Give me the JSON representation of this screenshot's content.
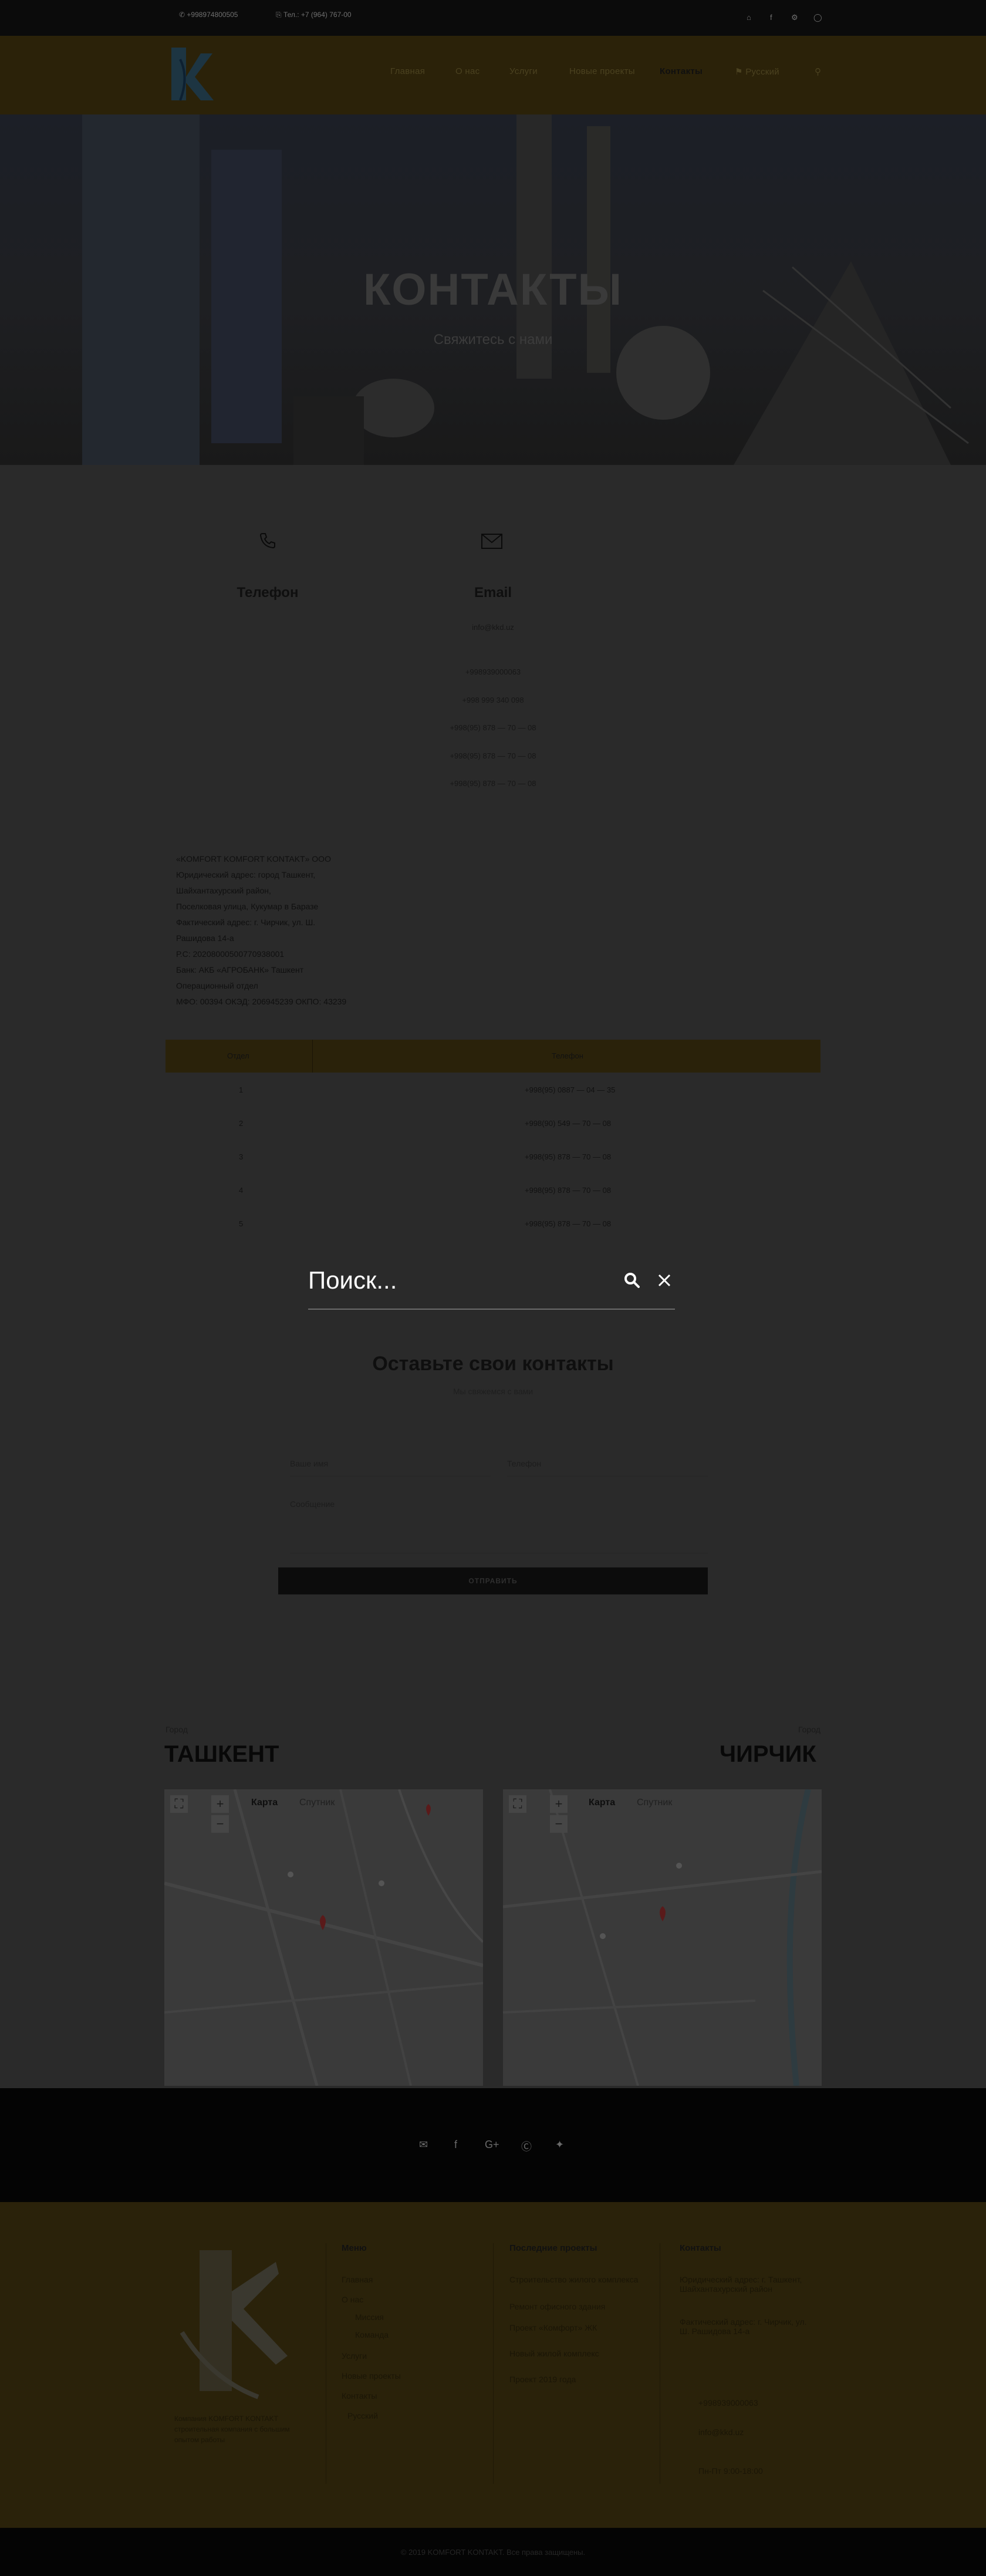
{
  "topbar": {
    "phone": "+998974800505",
    "fax": "Тел.: +7 (964) 767-00",
    "social_icons": [
      "home-icon",
      "facebook-icon",
      "settings-icon",
      "instagram-icon"
    ]
  },
  "nav": {
    "items": [
      "Главная",
      "О нас",
      "Услуги",
      "Новые проекты",
      "Контакты",
      "Русский"
    ],
    "active": "Контакты"
  },
  "hero": {
    "title": "КОНТАКТЫ",
    "subtitle": "Свяжитесь с нами"
  },
  "contacts": {
    "phone_label": "Телефон",
    "email_label": "Email",
    "email_value": "info@kkd.uz",
    "phones": [
      "+998939000063",
      "+998 999 340 098",
      "+998(95) 878 — 70 — 08",
      "+998(95) 878 — 70 — 08",
      "+998(95) 878 — 70 — 08"
    ]
  },
  "requisites": [
    "«KOMFORT KOMFORT KONTAKT» OOO",
    "Юридический адрес: город Ташкент,",
    "Шайхантахурский район,",
    "Поселковая улица, Кукумар в Баразе",
    "Фактический адрес: г. Чирчик, ул. Ш.",
    "Рашидова 14-а",
    "Р.С: 20208000500770938001",
    "Банк: АКБ «АГРОБАНК» Ташкент",
    "Операционный отдел",
    "МФО: 00394 ОКЭД: 206945239 ОКПО: 43239"
  ],
  "table": {
    "headers": [
      "Отдел",
      "Телефон"
    ],
    "rows": [
      [
        "1",
        "+998(95) 0887 — 04 — 35"
      ],
      [
        "2",
        "+998(90) 549 — 70 — 08"
      ],
      [
        "3",
        "+998(95) 878 — 70 — 08"
      ],
      [
        "4",
        "+998(95) 878 — 70 — 08"
      ],
      [
        "5",
        "+998(95) 878 — 70 — 08"
      ]
    ]
  },
  "search": {
    "placeholder": "Поиск..."
  },
  "form": {
    "title": "Оставьте свои контакты",
    "subtitle": "Мы свяжемся с вами",
    "name_placeholder": "Ваше имя",
    "phone_placeholder": "Телефон",
    "message_placeholder": "Сообщение",
    "submit": "ОТПРАВИТЬ"
  },
  "maps": [
    {
      "label": "Город",
      "city": "ТАШКЕНТ",
      "tab_map": "Карта",
      "tab_sat": "Спутник"
    },
    {
      "label": "Город",
      "city": "ЧИРЧИК",
      "tab_map": "Карта",
      "tab_sat": "Спутник"
    }
  ],
  "social_band": [
    "envelope-icon",
    "facebook-icon",
    "google-plus-icon",
    "skype-icon",
    "twitter-icon"
  ],
  "footer": {
    "about": "Компания KOMFORT KONTAKT строительная компания с большим опытом работы",
    "menu_title": "Меню",
    "menu": [
      "Главная",
      "О нас",
      "Миссия",
      "Команда",
      "Услуги",
      "Новые проекты",
      "Контакты",
      "Русский"
    ],
    "projects_title": "Последние проекты",
    "projects": [
      "Строительство жилого комплекса",
      "Ремонт офисного здания",
      "Проект «Комфорт» ЖК",
      "Новый жилой комплекс",
      "Проект 2019 года"
    ],
    "contacts_title": "Контакты",
    "contacts": [
      "Юридический адрес: г. Ташкент, Шайхантахурский район",
      "Фактический адрес: г. Чирчик, ул. Ш. Рашидова 14-а",
      "+998939000063",
      "info@kkd.uz",
      "Пн-Пт 9:00-18:00"
    ]
  },
  "copyright": "© 2019 KOMFORT KONTAKT. Все права защищены."
}
